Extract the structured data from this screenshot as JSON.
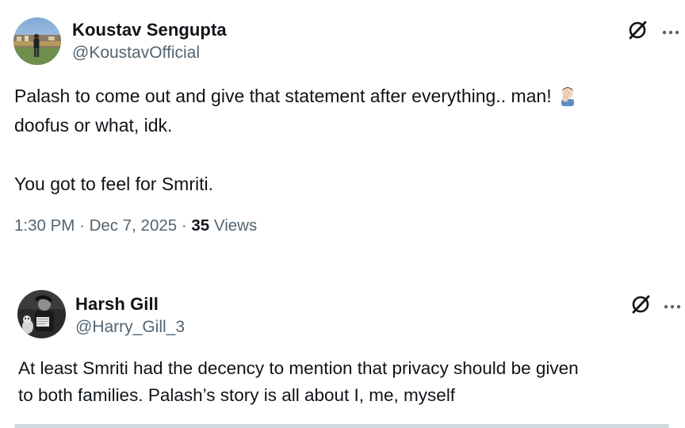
{
  "tweets": [
    {
      "author_name": "Koustav Sengupta",
      "handle": "@KoustavOfficial",
      "text_line1": "Palash to come out and give that statement after everything.. man!",
      "text_line2": "doofus or what, idk.",
      "text_line3": "You got to feel for Smriti.",
      "time": "1:30 PM",
      "date": "Dec 7, 2025",
      "views_count": "35",
      "views_label": "Views",
      "separator": "·",
      "emoji": "facepalm-emoji"
    },
    {
      "author_name": "Harsh Gill",
      "handle": "@Harry_Gill_3",
      "text_line1": "At least Smriti had the decency to mention that privacy should be given",
      "text_line2": "to both families. Palash’s story is all about I, me, myself"
    }
  ],
  "icons": {
    "grok": "grok-icon",
    "more": "more-icon"
  },
  "colors": {
    "text": "#0f1419",
    "secondary": "#536471",
    "background": "#ffffff"
  }
}
